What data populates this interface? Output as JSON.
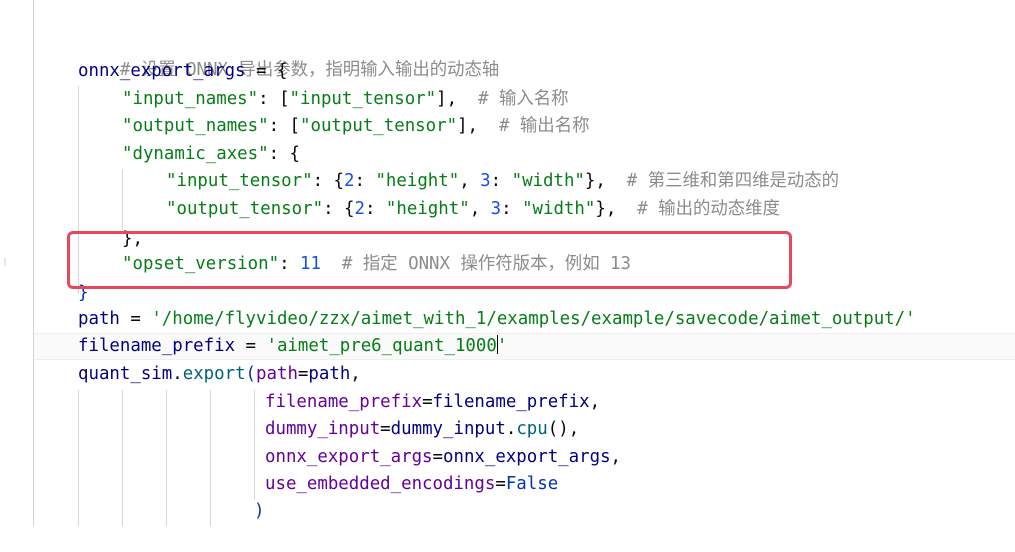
{
  "editor": {
    "comment_header": "# 设置 ONNX 导出参数，指明输入输出的动态轴",
    "lines": {
      "l2_var": "onnx_export_args",
      "l2_op": " = {",
      "l3_key": "\"input_names\"",
      "l3_sep": ": [",
      "l3_val": "\"input_tensor\"",
      "l3_end": "],  ",
      "l3_comment": "# 输入名称",
      "l4_key": "\"output_names\"",
      "l4_sep": ": [",
      "l4_val": "\"output_tensor\"",
      "l4_end": "],  ",
      "l4_comment": "# 输出名称",
      "l5_key": "\"dynamic_axes\"",
      "l5_sep": ": {",
      "l6_key": "\"input_tensor\"",
      "l6_sep": ": {",
      "l6_n1": "2",
      "l6_c1": ": ",
      "l6_v1": "\"height\"",
      "l6_c2": ", ",
      "l6_n2": "3",
      "l6_c3": ": ",
      "l6_v2": "\"width\"",
      "l6_end": "},  ",
      "l6_comment": "# 第三维和第四维是动态的",
      "l7_key": "\"output_tensor\"",
      "l7_sep": ": {",
      "l7_n1": "2",
      "l7_c1": ": ",
      "l7_v1": "\"height\"",
      "l7_c2": ", ",
      "l7_n2": "3",
      "l7_c3": ": ",
      "l7_v2": "\"width\"",
      "l7_end": "},  ",
      "l7_comment": "# 输出的动态维度",
      "l8": "},",
      "l9_key": "\"opset_version\"",
      "l9_sep": ": ",
      "l9_num": "11",
      "l9_gap": "  ",
      "l9_comment": "# 指定 ONNX 操作符版本，例如 13",
      "l10": "}",
      "l11_var": "path",
      "l11_op": " = ",
      "l11_val": "'/home/flyvideo/zzx/aimet_with_1/examples/example/savecode/aimet_output/'",
      "l12_var": "filename_prefix",
      "l12_op": " = ",
      "l12_val": "'aimet_pre6_quant_1000",
      "l12_val_end": "'",
      "l13_obj": "quant_sim",
      "l13_dot": ".",
      "l13_fn": "export",
      "l13_paren": "(",
      "l13_param": "path",
      "l13_eq": "=",
      "l13_arg": "path",
      "l13_end": ",",
      "l14_param": "filename_prefix",
      "l14_eq": "=",
      "l14_arg": "filename_prefix",
      "l14_end": ",",
      "l15_param": "dummy_input",
      "l15_eq": "=",
      "l15_arg": "dummy_input",
      "l15_dot": ".",
      "l15_fn": "cpu",
      "l15_call": "()",
      "l15_end": ",",
      "l16_param": "onnx_export_args",
      "l16_eq": "=",
      "l16_arg": "onnx_export_args",
      "l16_end": ",",
      "l17_param": "use_embedded_encodings",
      "l17_eq": "=",
      "l17_kw": "False",
      "l18": ")"
    }
  },
  "colors": {
    "highlight_box": "#e8475f",
    "comment": "#8c8c8c",
    "string": "#067d17",
    "number": "#1750eb",
    "keyword": "#0033b3",
    "function": "#00627a",
    "parameter": "#660099",
    "identifier": "#000080"
  }
}
